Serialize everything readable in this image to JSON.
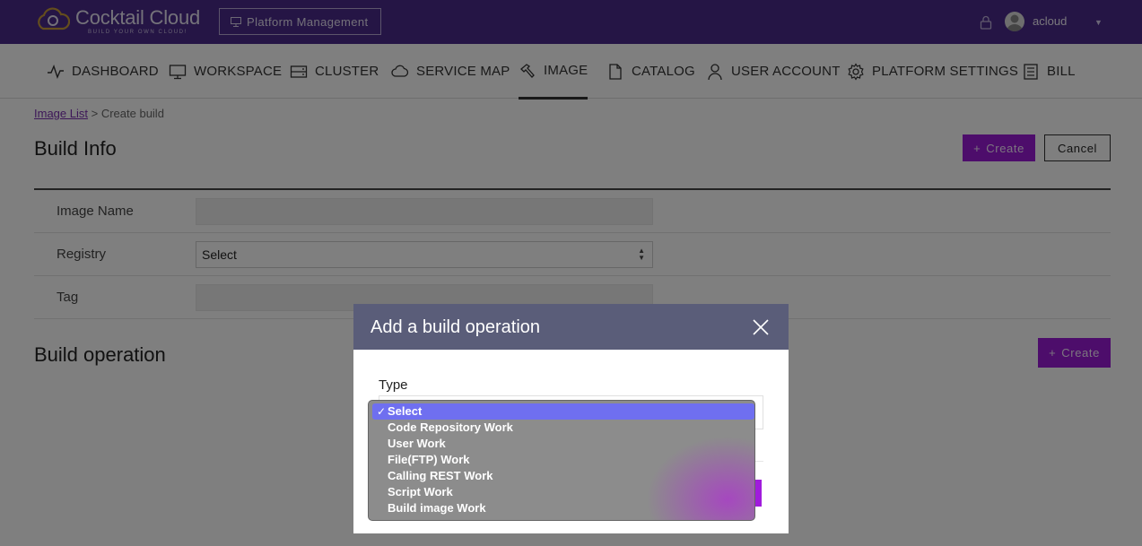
{
  "header": {
    "logo_title": "Cocktail Cloud",
    "logo_tagline": "BUILD YOUR OWN CLOUD!",
    "platform_button": "Platform Management",
    "username": "acloud"
  },
  "nav": {
    "items": [
      {
        "label": "DASHBOARD",
        "icon": "pulse-icon"
      },
      {
        "label": "WORKSPACE",
        "icon": "monitor-icon"
      },
      {
        "label": "CLUSTER",
        "icon": "server-icon"
      },
      {
        "label": "SERVICE MAP",
        "icon": "cloud-icon"
      },
      {
        "label": "IMAGE",
        "icon": "hammer-icon",
        "active": true
      },
      {
        "label": "CATALOG",
        "icon": "document-icon"
      },
      {
        "label": "USER ACCOUNT",
        "icon": "user-icon"
      },
      {
        "label": "PLATFORM SETTINGS",
        "icon": "gear-icon"
      },
      {
        "label": "BILL",
        "icon": "receipt-icon"
      }
    ]
  },
  "breadcrumb": {
    "link": "Image List",
    "separator": ">",
    "current": "Create build"
  },
  "build_info": {
    "title": "Build Info",
    "create_label": "Create",
    "cancel_label": "Cancel",
    "fields": [
      {
        "label": "Image Name",
        "value": ""
      },
      {
        "label": "Registry",
        "value": "Select"
      },
      {
        "label": "Tag",
        "value": ""
      }
    ]
  },
  "build_operation": {
    "title": "Build operation",
    "create_label": "Create"
  },
  "modal": {
    "title": "Add a build operation",
    "type_label": "Type",
    "options": [
      "Select",
      "Code Repository Work",
      "User Work",
      "File(FTP) Work",
      "Calling REST Work",
      "Script Work",
      "Build image Work"
    ],
    "selected": "Select",
    "check_mark": "✓"
  },
  "colors": {
    "topbar": "#4b2a8a",
    "accent": "#9b1bd6",
    "modal_header": "#5a5d79",
    "option_highlight": "#6f6ff0"
  }
}
